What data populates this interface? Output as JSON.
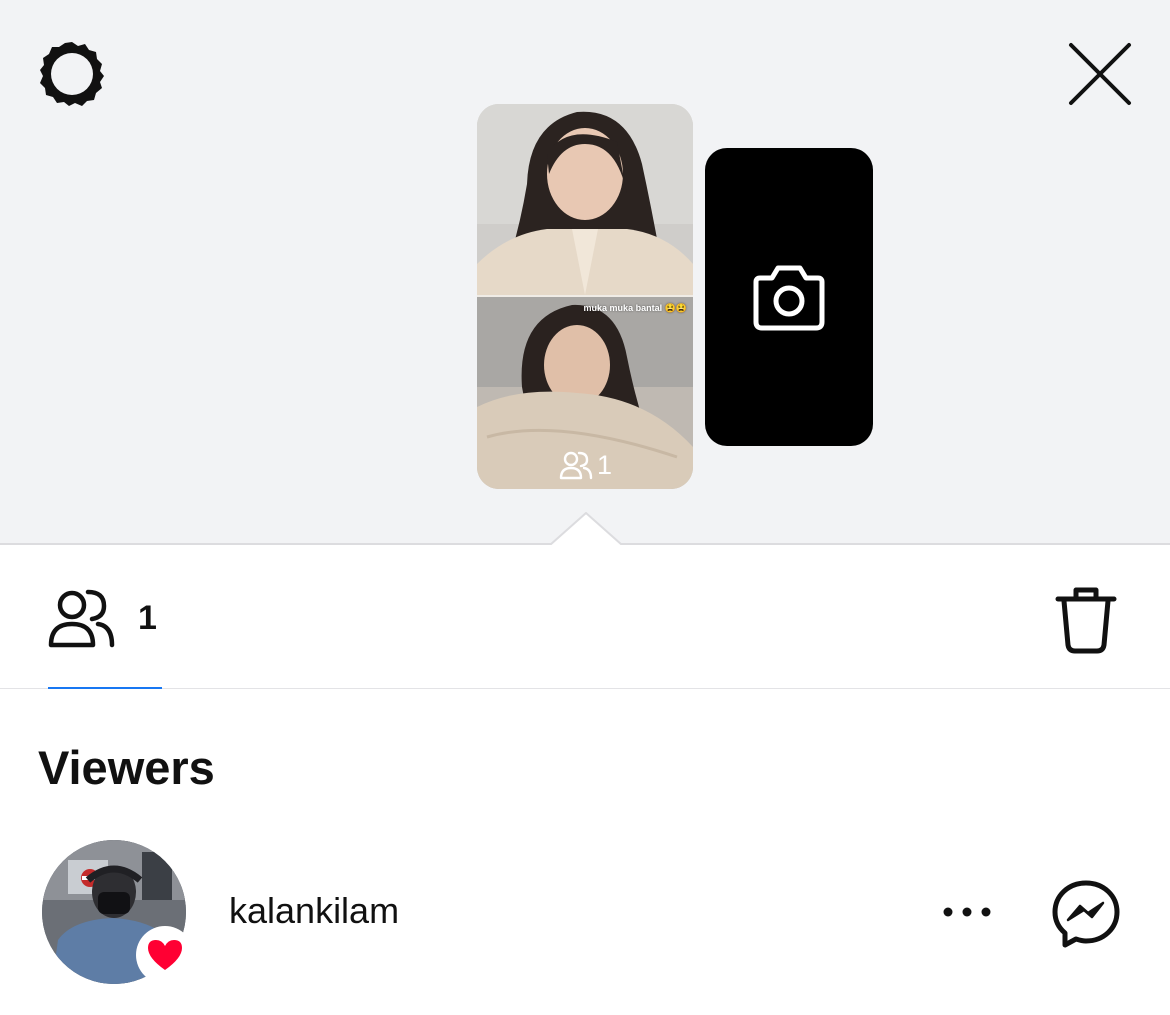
{
  "header": {
    "settings_icon": "settings-gear-icon",
    "close_icon": "close-x-icon"
  },
  "story": {
    "caption": "muka muka bantal 😫😫",
    "viewers_count": "1",
    "viewers_icon": "people-icon"
  },
  "camera_card": {
    "icon": "camera-icon"
  },
  "stats": {
    "viewers_count": "1",
    "viewers_icon": "people-icon",
    "delete_icon": "trash-icon",
    "active_tab_color": "#1877f2"
  },
  "viewers": {
    "heading": "Viewers",
    "list": [
      {
        "username": "kalankilam",
        "reaction_icon": "heart-icon",
        "reaction_color": "#ff0033",
        "more_icon": "more-horizontal-icon",
        "message_icon": "messenger-icon"
      }
    ]
  }
}
